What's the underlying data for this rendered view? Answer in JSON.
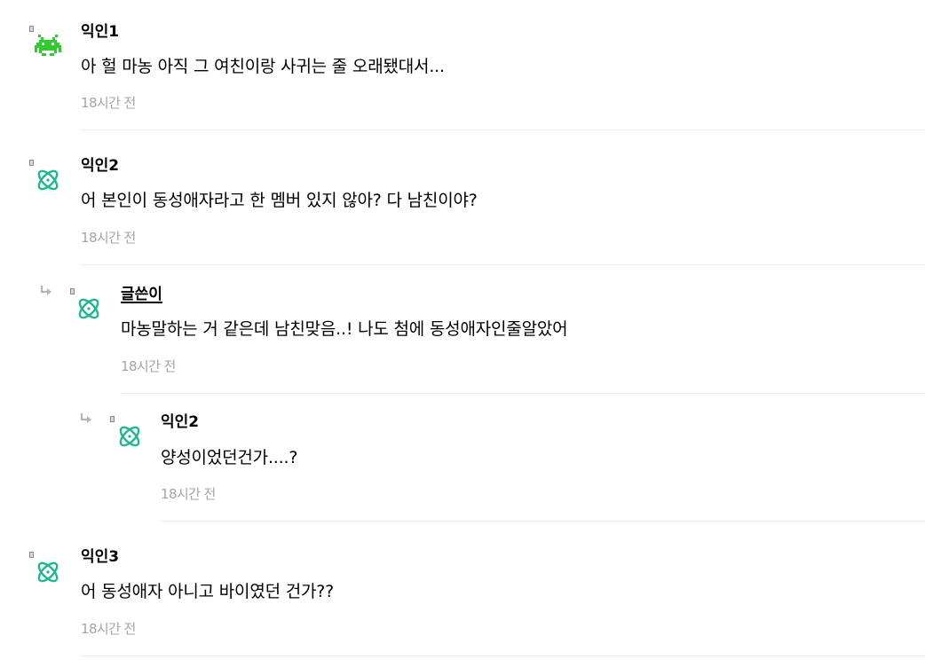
{
  "comments": [
    {
      "author": "익인1",
      "avatar_icon": "green-pixel-space-invader-icon",
      "text": "아 헐 마농 아직 그 여친이랑 사귀는 줄 오래됐대서...",
      "time": "18시간 전"
    },
    {
      "author": "익인2",
      "avatar_icon": "teal-atom-icon",
      "text": "어 본인이 동성애자라고 한 멤버 있지 않아? 다 남친이야?",
      "time": "18시간 전"
    },
    {
      "author": "글쓴이",
      "avatar_icon": "teal-atom-icon",
      "is_reply": true,
      "is_original_poster": true,
      "text": "마농말하는 거 같은데 남친맞음..! 나도 첨에 동성애자인줄알았어",
      "time": "18시간 전"
    },
    {
      "author": "익인2",
      "avatar_icon": "teal-atom-icon",
      "is_reply": true,
      "text": "양성이었던건가....?",
      "time": "18시간 전"
    },
    {
      "author": "익인3",
      "avatar_icon": "teal-atom-icon",
      "text": "어 동성애자 아니고 바이였던 건가??",
      "time": "18시간 전"
    }
  ],
  "colors": {
    "invader_green": "#2fcc2f",
    "atom_teal": "#1fb892",
    "meta_gray": "#a4a4a4",
    "divider": "#ececec"
  }
}
